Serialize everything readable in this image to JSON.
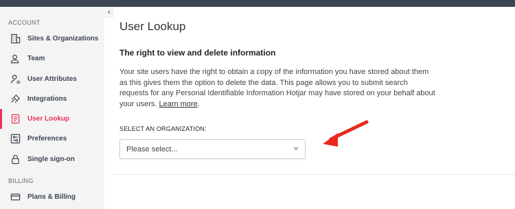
{
  "sidebar": {
    "collapse_glyph": "‹",
    "sections": {
      "account": "ACCOUNT",
      "billing": "BILLING"
    },
    "items": [
      {
        "label": "Sites & Organizations",
        "icon": "building-icon"
      },
      {
        "label": "Team",
        "icon": "users-icon"
      },
      {
        "label": "User Attributes",
        "icon": "user-attributes-icon"
      },
      {
        "label": "Integrations",
        "icon": "plug-icon"
      },
      {
        "label": "User Lookup",
        "icon": "document-icon",
        "active": true
      },
      {
        "label": "Preferences",
        "icon": "sliders-icon"
      },
      {
        "label": "Single sign-on",
        "icon": "lock-icon"
      },
      {
        "label": "Plans & Billing",
        "icon": "credit-card-icon"
      }
    ]
  },
  "main": {
    "title": "User Lookup",
    "heading": "The right to view and delete information",
    "body": "Your site users have the right to obtain a copy of the information you have stored about them as this gives them the option to delete the data. This page allows you to submit search requests for any Personal Identifiable Information Hotjar may have stored on your behalf about your users.",
    "learn_more": "Learn more",
    "learn_more_suffix": ".",
    "org_label": "SELECT AN ORGANIZATION:",
    "org_select_value": "Please select..."
  },
  "colors": {
    "accent": "#e8335a",
    "annotation_arrow": "#e8291c",
    "topbar": "#3c4552",
    "sidebar_bg": "#f4f4f4"
  }
}
